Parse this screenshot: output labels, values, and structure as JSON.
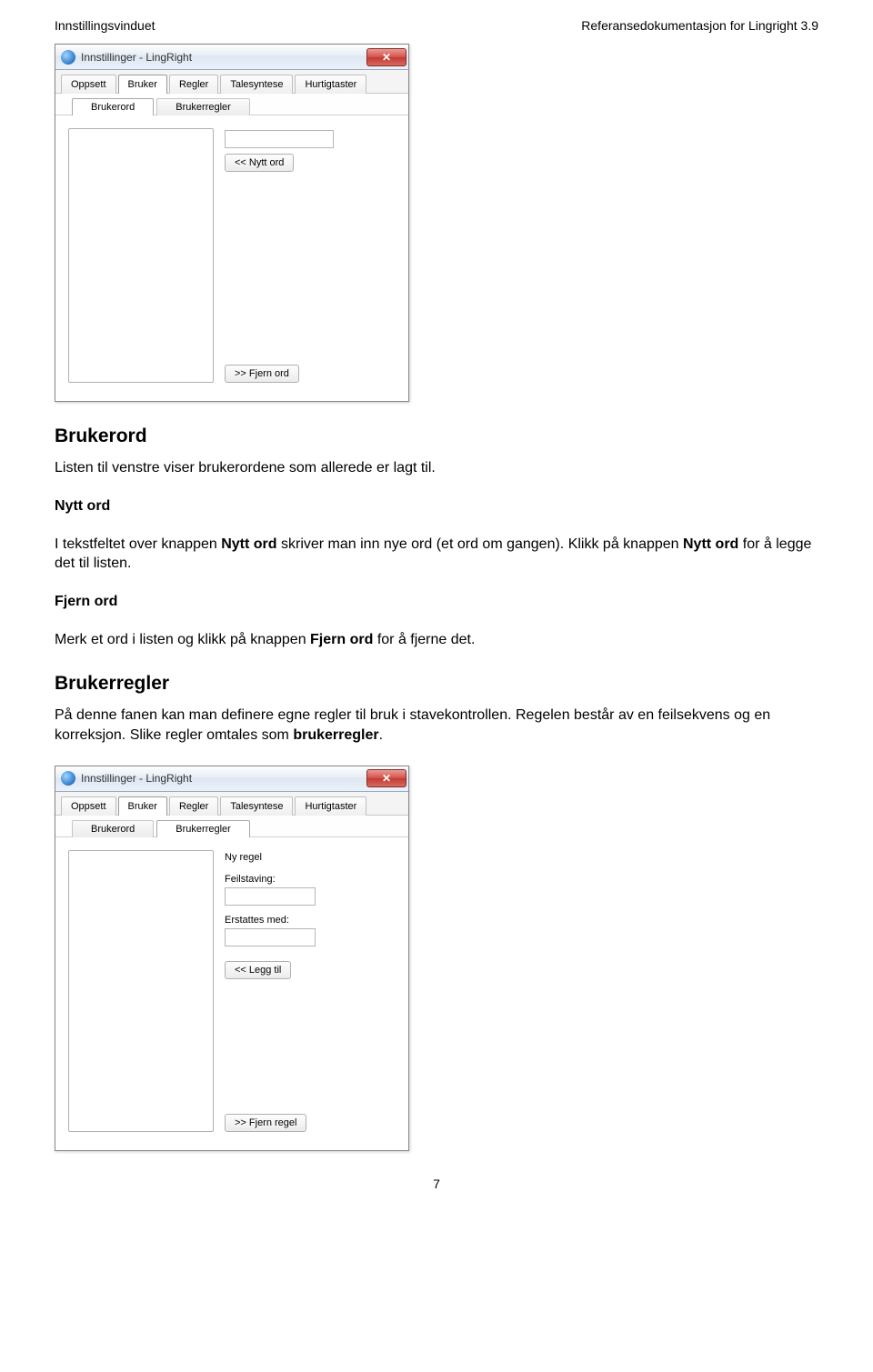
{
  "header": {
    "left": "Innstillingsvinduet",
    "right": "Referansedokumentasjon for Lingright 3.9"
  },
  "window_common": {
    "title": "Innstillinger - LingRight",
    "main_tabs": [
      "Oppsett",
      "Bruker",
      "Regler",
      "Talesyntese",
      "Hurtigtaster"
    ],
    "active_main_tab": "Bruker",
    "sub_tabs": [
      "Brukerord",
      "Brukerregler"
    ]
  },
  "screenshot1": {
    "active_sub_tab": "Brukerord",
    "btn_new_word": "<< Nytt ord",
    "btn_remove_word": ">> Fjern ord"
  },
  "screenshot2": {
    "active_sub_tab": "Brukerregler",
    "group_title": "Ny regel",
    "field_misspelling": "Feilstaving:",
    "field_replace": "Erstattes med:",
    "btn_add": "<< Legg til",
    "btn_remove": ">> Fjern regel"
  },
  "doc": {
    "h_brukerord": "Brukerord",
    "p_brukerord_intro": "Listen til venstre viser brukerordene som allerede er lagt til.",
    "sh_nytt_ord": "Nytt ord",
    "p_nytt_ord_1a": "I tekstfeltet over knappen ",
    "p_nytt_ord_1b": "Nytt ord",
    "p_nytt_ord_1c": " skriver man inn nye ord (et ord om gangen). Klikk på knappen ",
    "p_nytt_ord_1d": "Nytt ord",
    "p_nytt_ord_1e": " for å legge det til listen.",
    "sh_fjern_ord": "Fjern ord",
    "p_fjern_ord_a": "Merk et ord i listen og klikk på knappen ",
    "p_fjern_ord_b": "Fjern ord",
    "p_fjern_ord_c": " for å fjerne det.",
    "h_brukerregler": "Brukerregler",
    "p_brukerregler_a": "På denne fanen kan man definere egne regler til bruk i stavekontrollen. Regelen består av en feilsekvens og en korreksjon. Slike regler omtales som ",
    "p_brukerregler_b": "brukerregler",
    "p_brukerregler_c": "."
  },
  "page_number": "7"
}
